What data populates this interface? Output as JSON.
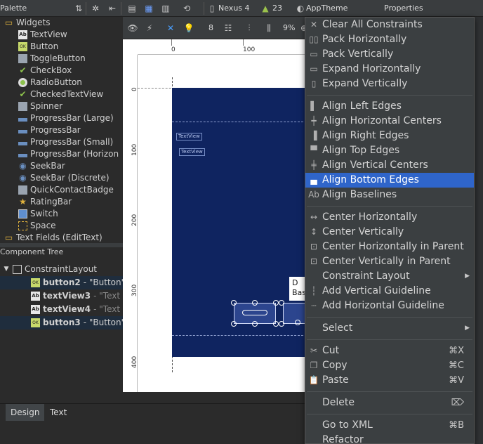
{
  "toolbar": {
    "palette_title": "Palette",
    "device": "Nexus 4",
    "api": "23",
    "theme": "AppTheme",
    "properties_title": "Properties"
  },
  "design_toolbar": {
    "margin_value": "8",
    "zoom": "9%"
  },
  "palette": {
    "items": [
      {
        "label": "Widgets",
        "icon": "folder-icon",
        "kind": "category"
      },
      {
        "label": "TextView",
        "icon": "textview-icon",
        "kind": "ab"
      },
      {
        "label": "Button",
        "icon": "button-icon",
        "kind": "ok"
      },
      {
        "label": "ToggleButton",
        "icon": "toggle-icon",
        "kind": "tgl"
      },
      {
        "label": "CheckBox",
        "icon": "checkbox-icon",
        "kind": "chk"
      },
      {
        "label": "RadioButton",
        "icon": "radio-icon",
        "kind": "radio"
      },
      {
        "label": "CheckedTextView",
        "icon": "checkedtext-icon",
        "kind": "chk"
      },
      {
        "label": "Spinner",
        "icon": "spinner-icon",
        "kind": "tgl"
      },
      {
        "label": "ProgressBar (Large)",
        "icon": "progressbar-icon",
        "kind": "bar"
      },
      {
        "label": "ProgressBar",
        "icon": "progressbar-icon",
        "kind": "bar"
      },
      {
        "label": "ProgressBar (Small)",
        "icon": "progressbar-icon",
        "kind": "bar"
      },
      {
        "label": "ProgressBar (Horizon",
        "icon": "progressbar-icon",
        "kind": "bar"
      },
      {
        "label": "SeekBar",
        "icon": "seekbar-icon",
        "kind": "seek"
      },
      {
        "label": "SeekBar (Discrete)",
        "icon": "seekbar-icon",
        "kind": "seek"
      },
      {
        "label": "QuickContactBadge",
        "icon": "contact-badge-icon",
        "kind": "tgl"
      },
      {
        "label": "RatingBar",
        "icon": "star-icon",
        "kind": "star"
      },
      {
        "label": "Switch",
        "icon": "switch-icon",
        "kind": "sw"
      },
      {
        "label": "Space",
        "icon": "space-icon",
        "kind": "space"
      },
      {
        "label": "Text Fields (EditText)",
        "icon": "folder-icon",
        "kind": "category"
      }
    ]
  },
  "component_tree": {
    "title": "Component Tree",
    "root": "ConstraintLayout",
    "children": [
      {
        "id": "button2",
        "type": "- \"Button\"",
        "selected": true,
        "kind": "ok"
      },
      {
        "id": "textView3",
        "type": "- \"Text",
        "selected": false,
        "kind": "ab"
      },
      {
        "id": "textView4",
        "type": "- \"Text",
        "selected": false,
        "kind": "ab"
      },
      {
        "id": "button3",
        "type": "- \"Button\"",
        "selected": true,
        "kind": "ok"
      }
    ]
  },
  "canvas": {
    "ruler_top": [
      "0",
      "100"
    ],
    "ruler_left": [
      "0",
      "100",
      "200",
      "300",
      "400"
    ],
    "textview_labels": [
      "TextView",
      "TextView"
    ],
    "tooltip": [
      "D",
      "Bas"
    ]
  },
  "bottom_tabs": {
    "design": "Design",
    "text": "Text"
  },
  "context_menu": {
    "items": [
      {
        "label": "Clear All Constraints",
        "icon": "clear-constraints-icon",
        "glyph": "✕"
      },
      {
        "label": "Pack Horizontally",
        "icon": "pack-horizontal-icon",
        "glyph": "▯▯"
      },
      {
        "label": "Pack Vertically",
        "icon": "pack-vertical-icon",
        "glyph": "▭"
      },
      {
        "label": "Expand Horizontally",
        "icon": "expand-horizontal-icon",
        "glyph": "▭"
      },
      {
        "label": "Expand Vertically",
        "icon": "expand-vertical-icon",
        "glyph": "▯"
      },
      {
        "sep": true
      },
      {
        "label": "Align Left Edges",
        "icon": "align-left-icon",
        "glyph": "▌"
      },
      {
        "label": "Align Horizontal Centers",
        "icon": "align-hcenter-icon",
        "glyph": "┿"
      },
      {
        "label": "Align Right Edges",
        "icon": "align-right-icon",
        "glyph": "▐"
      },
      {
        "label": "Align Top Edges",
        "icon": "align-top-icon",
        "glyph": "▀"
      },
      {
        "label": "Align Vertical Centers",
        "icon": "align-vcenter-icon",
        "glyph": "╪"
      },
      {
        "label": "Align Bottom Edges",
        "icon": "align-bottom-icon",
        "glyph": "▄",
        "highlighted": true
      },
      {
        "label": "Align Baselines",
        "icon": "align-baselines-icon",
        "glyph": "Ab"
      },
      {
        "sep": true
      },
      {
        "label": "Center Horizontally",
        "icon": "center-horizontal-icon",
        "glyph": "↔"
      },
      {
        "label": "Center Vertically",
        "icon": "center-vertical-icon",
        "glyph": "↕"
      },
      {
        "label": "Center Horizontally in Parent",
        "icon": "center-h-parent-icon",
        "glyph": "⊡"
      },
      {
        "label": "Center Vertically in Parent",
        "icon": "center-v-parent-icon",
        "glyph": "⊡"
      },
      {
        "label": "Constraint Layout",
        "icon": "",
        "glyph": "",
        "submenu": true
      },
      {
        "label": "Add Vertical Guideline",
        "icon": "vertical-guideline-icon",
        "glyph": "┆"
      },
      {
        "label": "Add Horizontal Guideline",
        "icon": "horizontal-guideline-icon",
        "glyph": "┄"
      },
      {
        "sep": true
      },
      {
        "label": "Select",
        "icon": "",
        "glyph": "",
        "submenu": true
      },
      {
        "sep": true
      },
      {
        "label": "Cut",
        "icon": "scissors-icon",
        "glyph": "✂",
        "shortcut": "⌘X"
      },
      {
        "label": "Copy",
        "icon": "copy-icon",
        "glyph": "❐",
        "shortcut": "⌘C"
      },
      {
        "label": "Paste",
        "icon": "paste-icon",
        "glyph": "📋",
        "shortcut": "⌘V"
      },
      {
        "sep": true
      },
      {
        "label": "Delete",
        "icon": "",
        "glyph": "",
        "shortcut": "⌦"
      },
      {
        "sep": true
      },
      {
        "label": "Go to XML",
        "icon": "",
        "glyph": "",
        "shortcut": "⌘B"
      },
      {
        "label": "Refactor",
        "icon": "",
        "glyph": ""
      }
    ]
  },
  "colors": {
    "highlight": "#2f65ca",
    "device_bg": "#0f2460",
    "menu_bg": "#3b3f41"
  }
}
